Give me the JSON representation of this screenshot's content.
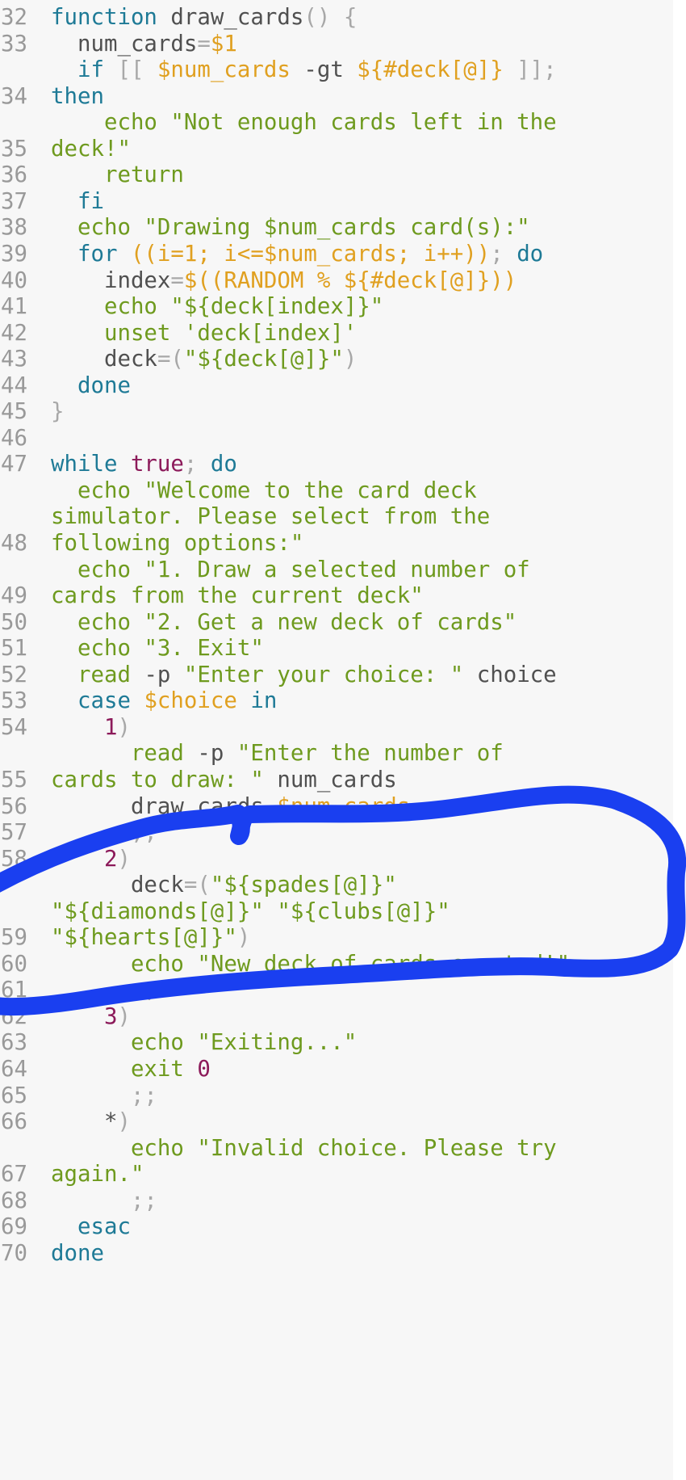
{
  "editor": {
    "language": "bash",
    "annotation_color": "#1a3ff0",
    "colors": {
      "keyword": "#1e7a96",
      "builtin": "#6e9a1e",
      "string": "#6e9a1e",
      "variable": "#e0a020",
      "punctuation": "#a8a8a8",
      "number": "#8c1a5a",
      "plain": "#505050",
      "line_number": "#999999",
      "background": "#f7f7f7"
    },
    "rows": [
      {
        "ln": "32",
        "tokens": [
          [
            "kw",
            "function"
          ],
          [
            "plain",
            " draw_cards"
          ],
          [
            "punc",
            "() {"
          ]
        ]
      },
      {
        "ln": "33",
        "tokens": [
          [
            "plain",
            "  num_cards"
          ],
          [
            "punc",
            "="
          ],
          [
            "var",
            "$1"
          ]
        ]
      },
      {
        "ln": "",
        "tokens": [
          [
            "kw",
            "  if"
          ],
          [
            "punc",
            " [[ "
          ],
          [
            "var",
            "$num_cards"
          ],
          [
            "plain",
            " -gt "
          ],
          [
            "var",
            "${#deck[@]}"
          ],
          [
            "punc",
            " ]];"
          ]
        ]
      },
      {
        "ln": "34",
        "tokens": [
          [
            "kw",
            "then"
          ]
        ]
      },
      {
        "ln": "",
        "tokens": [
          [
            "cmd",
            "    echo"
          ],
          [
            "str",
            " \"Not enough cards left in the"
          ]
        ]
      },
      {
        "ln": "35",
        "tokens": [
          [
            "str",
            "deck!\""
          ]
        ]
      },
      {
        "ln": "36",
        "tokens": [
          [
            "cmd",
            "    return"
          ]
        ]
      },
      {
        "ln": "37",
        "tokens": [
          [
            "kw",
            "  fi"
          ]
        ]
      },
      {
        "ln": "38",
        "tokens": [
          [
            "cmd",
            "  echo"
          ],
          [
            "str",
            " \"Drawing $num_cards card(s):\""
          ]
        ]
      },
      {
        "ln": "39",
        "tokens": [
          [
            "kw",
            "  for"
          ],
          [
            "var",
            " ((i=1; i<=$num_cards; i++))"
          ],
          [
            "punc",
            ";"
          ],
          [
            "kw",
            " do"
          ]
        ]
      },
      {
        "ln": "40",
        "tokens": [
          [
            "plain",
            "    index"
          ],
          [
            "punc",
            "="
          ],
          [
            "var",
            "$((RANDOM % ${#deck[@]}))"
          ]
        ]
      },
      {
        "ln": "41",
        "tokens": [
          [
            "cmd",
            "    echo"
          ],
          [
            "str",
            " \"${deck[index]}\""
          ]
        ]
      },
      {
        "ln": "42",
        "tokens": [
          [
            "cmd",
            "    unset"
          ],
          [
            "str",
            " 'deck[index]'"
          ]
        ]
      },
      {
        "ln": "43",
        "tokens": [
          [
            "plain",
            "    deck"
          ],
          [
            "punc",
            "=("
          ],
          [
            "str",
            "\"${deck[@]}\""
          ],
          [
            "punc",
            ")"
          ]
        ]
      },
      {
        "ln": "44",
        "tokens": [
          [
            "kw",
            "  done"
          ]
        ]
      },
      {
        "ln": "45",
        "tokens": [
          [
            "punc",
            "}"
          ]
        ]
      },
      {
        "ln": "46",
        "tokens": []
      },
      {
        "ln": "47",
        "tokens": [
          [
            "kw",
            "while"
          ],
          [
            "num",
            " true"
          ],
          [
            "punc",
            ";"
          ],
          [
            "kw",
            " do"
          ]
        ]
      },
      {
        "ln": "",
        "tokens": [
          [
            "cmd",
            "  echo"
          ],
          [
            "str",
            " \"Welcome to the card deck"
          ]
        ]
      },
      {
        "ln": "",
        "tokens": [
          [
            "str",
            "simulator. Please select from the"
          ]
        ]
      },
      {
        "ln": "48",
        "tokens": [
          [
            "str",
            "following options:\""
          ]
        ]
      },
      {
        "ln": "",
        "tokens": [
          [
            "cmd",
            "  echo"
          ],
          [
            "str",
            " \"1. Draw a selected number of"
          ]
        ]
      },
      {
        "ln": "49",
        "tokens": [
          [
            "str",
            "cards from the current deck\""
          ]
        ]
      },
      {
        "ln": "50",
        "tokens": [
          [
            "cmd",
            "  echo"
          ],
          [
            "str",
            " \"2. Get a new deck of cards\""
          ]
        ]
      },
      {
        "ln": "51",
        "tokens": [
          [
            "cmd",
            "  echo"
          ],
          [
            "str",
            " \"3. Exit\""
          ]
        ]
      },
      {
        "ln": "52",
        "tokens": [
          [
            "cmd",
            "  read"
          ],
          [
            "plain",
            " -p "
          ],
          [
            "str",
            "\"Enter your choice: \""
          ],
          [
            "plain",
            " choice"
          ]
        ]
      },
      {
        "ln": "53",
        "tokens": [
          [
            "kw",
            "  case"
          ],
          [
            "var",
            " $choice"
          ],
          [
            "kw",
            " in"
          ]
        ]
      },
      {
        "ln": "54",
        "tokens": [
          [
            "num",
            "    1"
          ],
          [
            "punc",
            ")"
          ]
        ]
      },
      {
        "ln": "",
        "tokens": [
          [
            "cmd",
            "      read"
          ],
          [
            "plain",
            " -p "
          ],
          [
            "str",
            "\"Enter the number of"
          ]
        ]
      },
      {
        "ln": "55",
        "tokens": [
          [
            "str",
            "cards to draw: \""
          ],
          [
            "plain",
            " num_cards"
          ]
        ]
      },
      {
        "ln": "56",
        "tokens": [
          [
            "plain",
            "      draw_cards "
          ],
          [
            "var",
            "$num_cards"
          ]
        ]
      },
      {
        "ln": "57",
        "tokens": [
          [
            "punc",
            "      ;;"
          ]
        ]
      },
      {
        "ln": "58",
        "tokens": [
          [
            "num",
            "    2"
          ],
          [
            "punc",
            ")"
          ]
        ]
      },
      {
        "ln": "",
        "tokens": [
          [
            "plain",
            "      deck"
          ],
          [
            "punc",
            "=("
          ],
          [
            "str",
            "\"${spades[@]}\""
          ]
        ]
      },
      {
        "ln": "",
        "tokens": [
          [
            "str",
            "\"${diamonds[@]}\" \"${clubs[@]}\""
          ]
        ]
      },
      {
        "ln": "59",
        "tokens": [
          [
            "str",
            "\"${hearts[@]}\""
          ],
          [
            "punc",
            ")"
          ]
        ]
      },
      {
        "ln": "60",
        "tokens": [
          [
            "cmd",
            "      echo"
          ],
          [
            "str",
            " \"New deck of cards created!\""
          ]
        ]
      },
      {
        "ln": "61",
        "tokens": [
          [
            "punc",
            "      ;;"
          ]
        ]
      },
      {
        "ln": "62",
        "tokens": [
          [
            "num",
            "    3"
          ],
          [
            "punc",
            ")"
          ]
        ]
      },
      {
        "ln": "63",
        "tokens": [
          [
            "cmd",
            "      echo"
          ],
          [
            "str",
            " \"Exiting...\""
          ]
        ]
      },
      {
        "ln": "64",
        "tokens": [
          [
            "cmd",
            "      exit"
          ],
          [
            "num",
            " 0"
          ]
        ]
      },
      {
        "ln": "65",
        "tokens": [
          [
            "punc",
            "      ;;"
          ]
        ]
      },
      {
        "ln": "66",
        "tokens": [
          [
            "plain",
            "    *"
          ],
          [
            "punc",
            ")"
          ]
        ]
      },
      {
        "ln": "",
        "tokens": [
          [
            "cmd",
            "      echo"
          ],
          [
            "str",
            " \"Invalid choice. Please try"
          ]
        ]
      },
      {
        "ln": "67",
        "tokens": [
          [
            "str",
            "again.\""
          ]
        ]
      },
      {
        "ln": "68",
        "tokens": [
          [
            "punc",
            "      ;;"
          ]
        ]
      },
      {
        "ln": "69",
        "tokens": [
          [
            "kw",
            "  esac"
          ]
        ]
      },
      {
        "ln": "70",
        "tokens": [
          [
            "kw",
            "done"
          ]
        ]
      }
    ]
  }
}
